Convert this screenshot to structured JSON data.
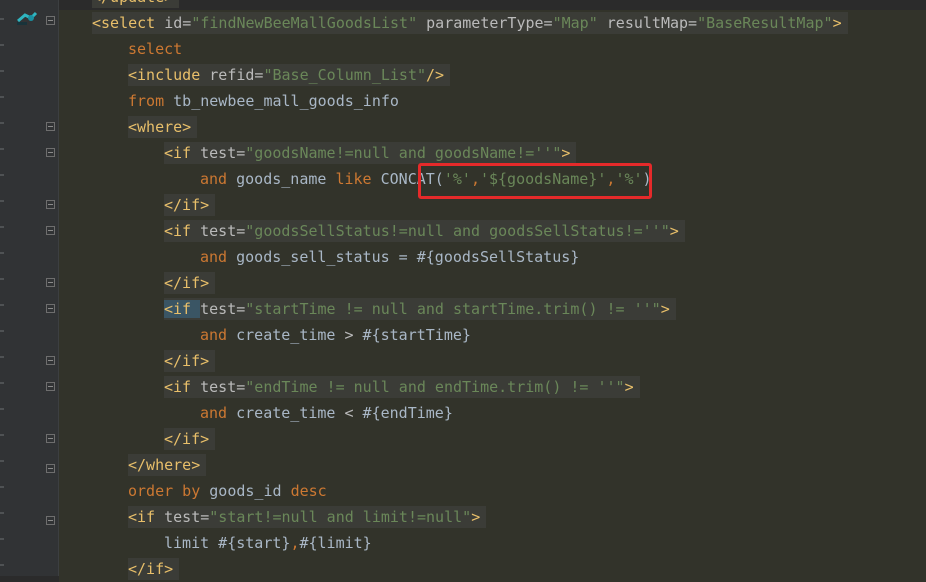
{
  "lines": [
    {
      "tokens": [
        {
          "c": "t",
          "v": "</update>"
        }
      ]
    },
    {
      "tokens": [
        {
          "c": "t",
          "v": "<select "
        },
        {
          "c": "an",
          "v": "id="
        },
        {
          "c": "av",
          "v": "\"findNewBeeMallGoodsList\""
        },
        {
          "c": "an",
          "v": " parameterType="
        },
        {
          "c": "av",
          "v": "\"Map\""
        },
        {
          "c": "an",
          "v": " resultMap="
        },
        {
          "c": "av",
          "v": "\"BaseResultMap\""
        },
        {
          "c": "t",
          "v": ">"
        }
      ]
    },
    {
      "tokens": [
        {
          "c": "kw",
          "v": "select"
        }
      ]
    },
    {
      "tokens": [
        {
          "c": "t",
          "v": "<include "
        },
        {
          "c": "an",
          "v": "refid="
        },
        {
          "c": "av",
          "v": "\"Base_Column_List\""
        },
        {
          "c": "t",
          "v": "/>"
        }
      ]
    },
    {
      "tokens": [
        {
          "c": "kw",
          "v": "from "
        },
        {
          "c": "tx",
          "v": "tb_newbee_mall_goods_info"
        }
      ]
    },
    {
      "tokens": [
        {
          "c": "t",
          "v": "<where>"
        }
      ]
    },
    {
      "tokens": [
        {
          "c": "t",
          "v": "<if "
        },
        {
          "c": "an",
          "v": "test="
        },
        {
          "c": "av",
          "v": "\"goodsName!=null and goodsName!=''\""
        },
        {
          "c": "t",
          "v": ">"
        }
      ]
    },
    {
      "tokens": [
        {
          "c": "kw",
          "v": "and "
        },
        {
          "c": "tx",
          "v": "goods_name "
        },
        {
          "c": "kw",
          "v": "like "
        },
        {
          "c": "tx",
          "v": "CONCAT("
        },
        {
          "c": "str",
          "v": "'%'"
        },
        {
          "c": "kw",
          "v": ","
        },
        {
          "c": "str",
          "v": "'${goodsName}'"
        },
        {
          "c": "kw",
          "v": ","
        },
        {
          "c": "str",
          "v": "'%'"
        },
        {
          "c": "tx",
          "v": ")"
        }
      ]
    },
    {
      "tokens": [
        {
          "c": "t",
          "v": "</if>"
        }
      ]
    },
    {
      "tokens": [
        {
          "c": "t",
          "v": "<if "
        },
        {
          "c": "an",
          "v": "test="
        },
        {
          "c": "av",
          "v": "\"goodsSellStatus!=null and goodsSellStatus!=''\""
        },
        {
          "c": "t",
          "v": ">"
        }
      ]
    },
    {
      "tokens": [
        {
          "c": "kw",
          "v": "and "
        },
        {
          "c": "tx",
          "v": "goods_sell_status = #{goodsSellStatus}"
        }
      ]
    },
    {
      "tokens": [
        {
          "c": "t",
          "v": "</if>"
        }
      ]
    },
    {
      "tokens": [
        {
          "c": "t",
          "v": "<if "
        },
        {
          "c": "an",
          "v": "test="
        },
        {
          "c": "av",
          "v": "\"startTime != null and startTime.trim() != ''\""
        },
        {
          "c": "t",
          "v": ">"
        }
      ]
    },
    {
      "tokens": [
        {
          "c": "kw",
          "v": "and "
        },
        {
          "c": "tx",
          "v": "create_time "
        },
        {
          "c": "an",
          "v": ">"
        },
        {
          "c": "tx",
          "v": " #{startTime}"
        }
      ]
    },
    {
      "tokens": [
        {
          "c": "t",
          "v": "</if>"
        }
      ]
    },
    {
      "tokens": [
        {
          "c": "t",
          "v": "<if "
        },
        {
          "c": "an",
          "v": "test="
        },
        {
          "c": "av",
          "v": "\"endTime != null and endTime.trim() != ''\""
        },
        {
          "c": "t",
          "v": ">"
        }
      ]
    },
    {
      "tokens": [
        {
          "c": "kw",
          "v": "and "
        },
        {
          "c": "tx",
          "v": "create_time "
        },
        {
          "c": "an",
          "v": "<"
        },
        {
          "c": "tx",
          "v": " #{endTime}"
        }
      ]
    },
    {
      "tokens": [
        {
          "c": "t",
          "v": "</if>"
        }
      ]
    },
    {
      "tokens": [
        {
          "c": "t",
          "v": "</where>"
        }
      ]
    },
    {
      "tokens": [
        {
          "c": "kw",
          "v": "order by "
        },
        {
          "c": "tx",
          "v": "goods_id "
        },
        {
          "c": "kw",
          "v": "desc"
        }
      ]
    },
    {
      "tokens": [
        {
          "c": "t",
          "v": "<if "
        },
        {
          "c": "an",
          "v": "test="
        },
        {
          "c": "av",
          "v": "\"start!=null and limit!=null\""
        },
        {
          "c": "t",
          "v": ">"
        }
      ]
    },
    {
      "tokens": [
        {
          "c": "tx",
          "v": "limit #{start}"
        },
        {
          "c": "kw",
          "v": ","
        },
        {
          "c": "tx",
          "v": "#{limit}"
        }
      ]
    },
    {
      "tokens": [
        {
          "c": "t",
          "v": "</if>"
        }
      ]
    }
  ],
  "gutter_icons": [
    "spring-bean-icon",
    "lightbulb-icon"
  ]
}
